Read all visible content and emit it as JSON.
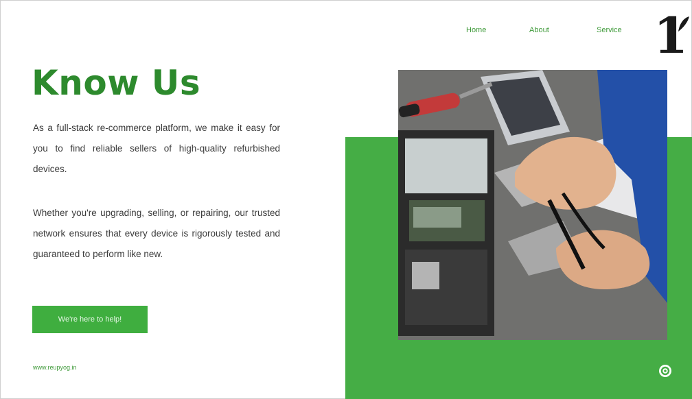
{
  "nav": {
    "home": "Home",
    "about": "About",
    "service": "Service"
  },
  "logo": {
    "mark": "1"
  },
  "hero": {
    "title": "Know Us",
    "paragraph1": "As a full-stack re-commerce platform, we make it easy for you to find reliable sellers of high-quality refurbished devices.",
    "paragraph2": "Whether you're upgrading, selling, or repairing, our trusted network ensures that every device is rigorously tested and guaranteed to perform like new.",
    "cta_label": "We're here to help!",
    "website": "www.reupyog.in"
  },
  "colors": {
    "brand_green": "#2d8a2d",
    "panel_green": "#45ad45",
    "button_green": "#3fae3f"
  },
  "icons": {
    "settings": "gear-icon"
  }
}
